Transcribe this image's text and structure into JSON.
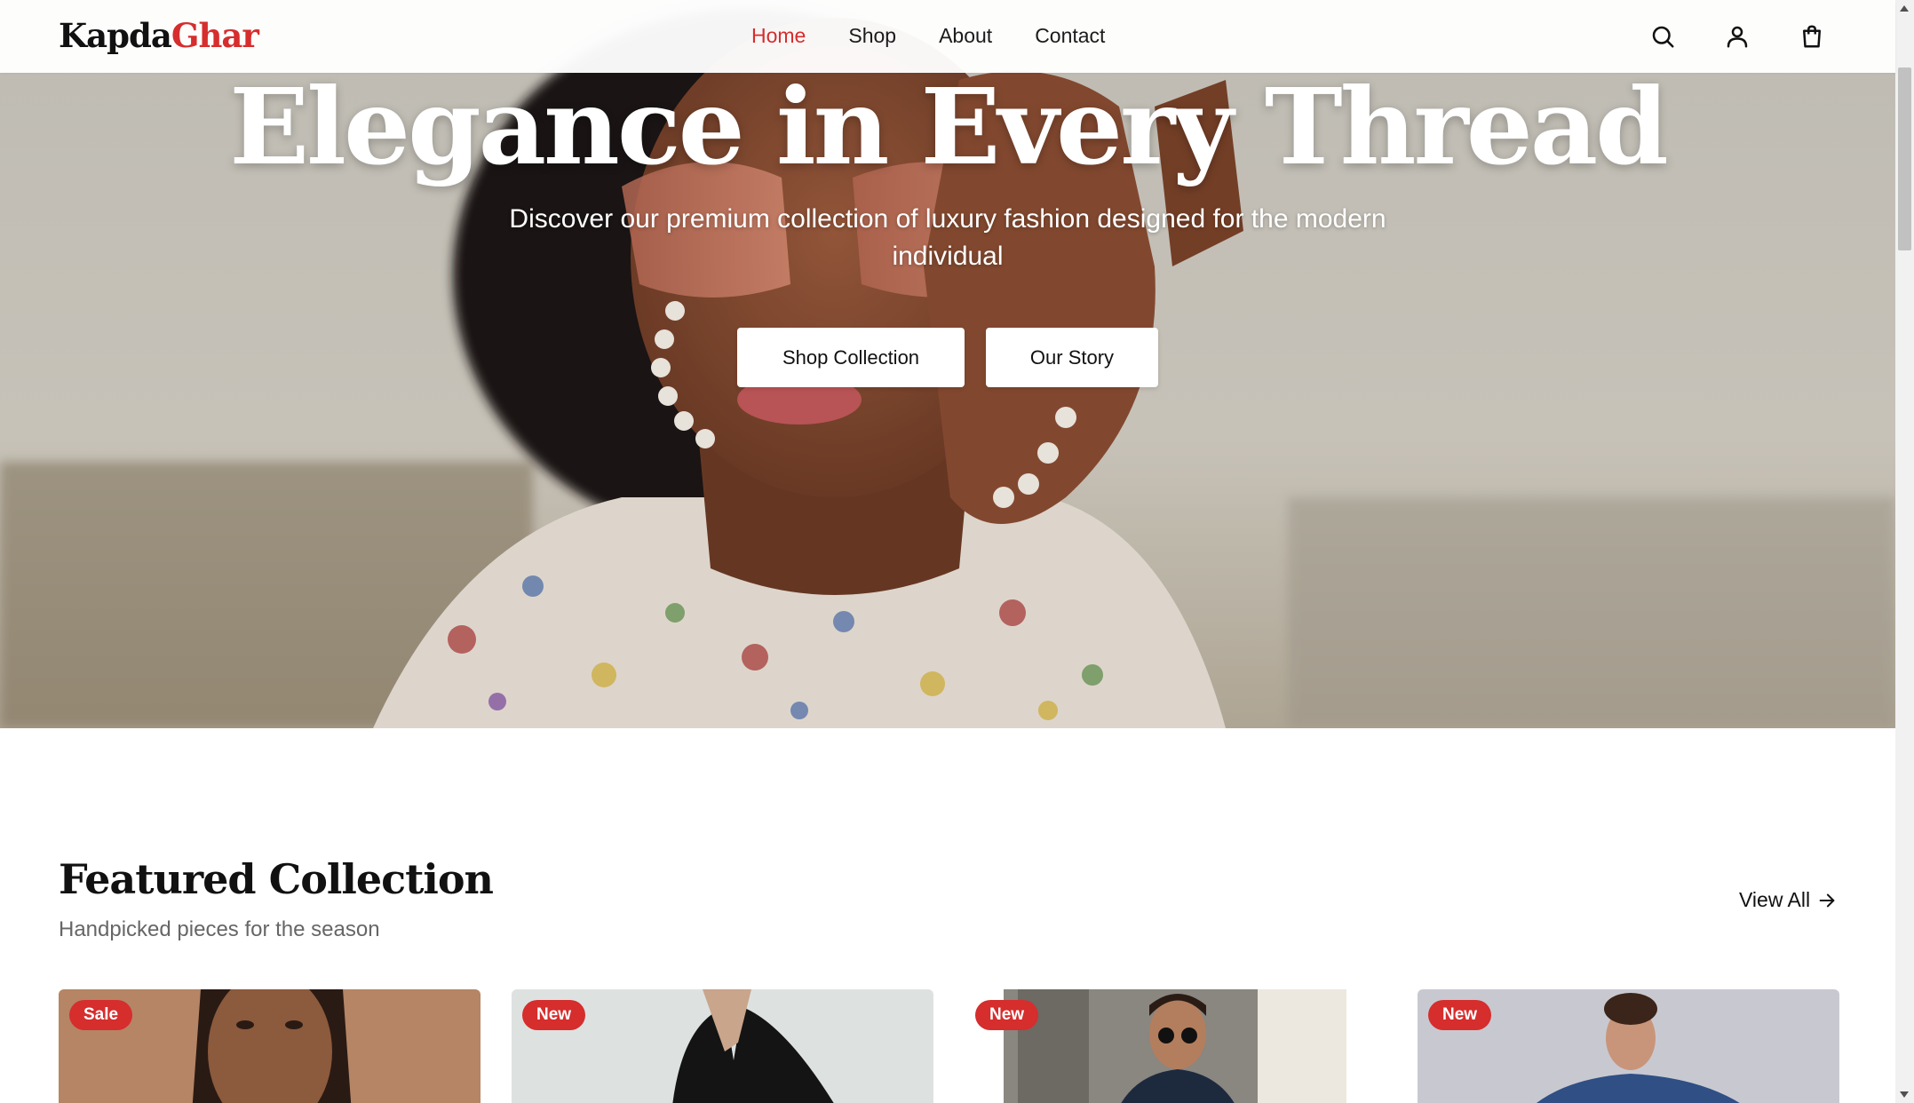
{
  "header": {
    "logo_part1": "Kapda",
    "logo_part2": "Ghar",
    "nav": [
      {
        "label": "Home",
        "active": true
      },
      {
        "label": "Shop"
      },
      {
        "label": "About"
      },
      {
        "label": "Contact"
      }
    ],
    "icons": [
      "search-icon",
      "user-icon",
      "cart-icon"
    ]
  },
  "hero": {
    "title": "Elegance in Every Thread",
    "subtitle": "Discover our premium collection of luxury fashion designed for the modern individual",
    "primary_button": "Shop Collection",
    "secondary_button": "Our Story"
  },
  "featured": {
    "title": "Featured Collection",
    "subtitle": "Handpicked pieces for the season",
    "view_all": "View All",
    "products": [
      {
        "badge": "Sale"
      },
      {
        "badge": "New"
      },
      {
        "badge": "New"
      },
      {
        "badge": "New"
      }
    ]
  },
  "colors": {
    "accent": "#d62d2d",
    "text": "#111111",
    "muted": "#666666"
  }
}
